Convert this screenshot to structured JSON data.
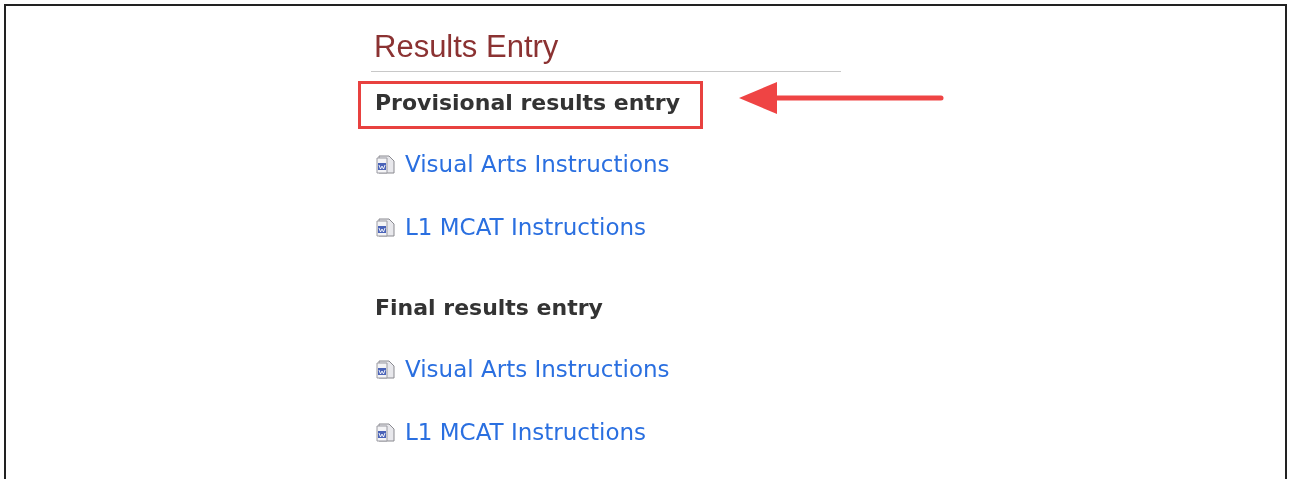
{
  "page": {
    "title": "Results Entry"
  },
  "sections": [
    {
      "heading": "Provisional results entry",
      "highlighted": true,
      "links": [
        "Visual Arts Instructions",
        "L1 MCAT Instructions"
      ]
    },
    {
      "heading": "Final results entry",
      "highlighted": false,
      "links": [
        "Visual Arts Instructions",
        "L1 MCAT Instructions"
      ]
    }
  ]
}
